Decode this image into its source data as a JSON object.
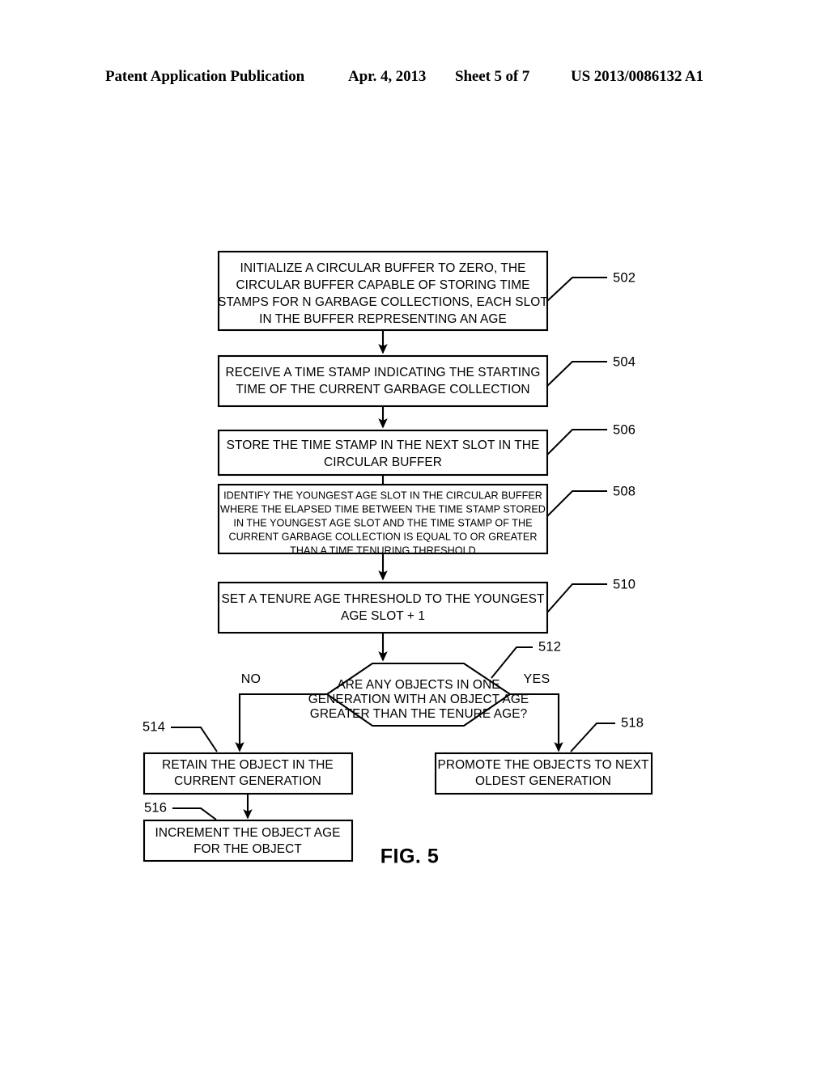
{
  "header": {
    "publication": "Patent Application Publication",
    "date": "Apr. 4, 2013",
    "sheet": "Sheet 5 of 7",
    "patent_number": "US 2013/0086132 A1"
  },
  "figure": {
    "label": "FIG. 5",
    "nodes": [
      {
        "ref": "502",
        "shape": "process",
        "lines": [
          "INITIALIZE A CIRCULAR BUFFER TO ZERO, THE",
          "CIRCULAR BUFFER CAPABLE OF STORING TIME",
          "STAMPS FOR N GARBAGE COLLECTIONS, EACH SLOT",
          "IN THE BUFFER REPRESENTING AN AGE"
        ]
      },
      {
        "ref": "504",
        "shape": "process",
        "lines": [
          "RECEIVE A TIME STAMP INDICATING THE STARTING",
          "TIME OF THE CURRENT GARBAGE COLLECTION"
        ]
      },
      {
        "ref": "506",
        "shape": "process",
        "lines": [
          "STORE THE TIME STAMP IN THE NEXT SLOT IN THE",
          "CIRCULAR BUFFER"
        ]
      },
      {
        "ref": "508",
        "shape": "process",
        "lines": [
          "IDENTIFY THE YOUNGEST AGE SLOT IN THE CIRCULAR BUFFER",
          "WHERE THE ELAPSED TIME BETWEEN THE TIME STAMP STORED",
          "IN THE YOUNGEST AGE SLOT AND THE TIME STAMP OF THE",
          "CURRENT GARBAGE COLLECTION IS EQUAL TO OR GREATER",
          "THAN A TIME TENURING THRESHOLD"
        ]
      },
      {
        "ref": "510",
        "shape": "process",
        "lines": [
          "SET A TENURE AGE THRESHOLD TO THE YOUNGEST",
          "AGE SLOT + 1"
        ]
      },
      {
        "ref": "512",
        "shape": "decision",
        "lines": [
          "ARE ANY OBJECTS IN ONE",
          "GENERATION WITH AN OBJECT AGE",
          "GREATER THAN THE TENURE AGE?"
        ]
      },
      {
        "ref": "514",
        "shape": "process",
        "lines": [
          "RETAIN THE OBJECT IN THE",
          "CURRENT GENERATION"
        ]
      },
      {
        "ref": "516",
        "shape": "process",
        "lines": [
          "INCREMENT THE OBJECT AGE",
          "FOR THE OBJECT"
        ]
      },
      {
        "ref": "518",
        "shape": "process",
        "lines": [
          "PROMOTE THE OBJECTS TO NEXT",
          "OLDEST GENERATION"
        ]
      }
    ],
    "branch_labels": {
      "no": "NO",
      "yes": "YES"
    }
  }
}
